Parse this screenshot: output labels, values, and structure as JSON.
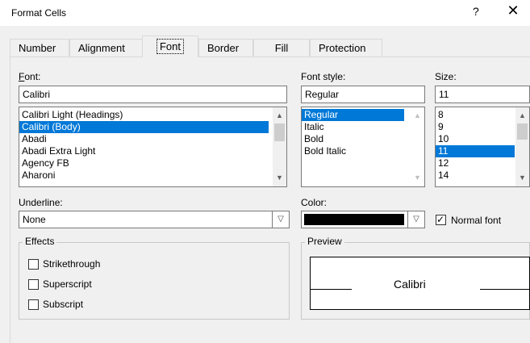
{
  "window": {
    "title": "Format Cells",
    "help": "?",
    "close": "✕"
  },
  "tabs": [
    "Number",
    "Alignment",
    "Font",
    "Border",
    "Fill",
    "Protection"
  ],
  "font": {
    "label": "Font:",
    "value": "Calibri",
    "items": [
      "Calibri Light (Headings)",
      "Calibri (Body)",
      "Abadi",
      "Abadi Extra Light",
      "Agency FB",
      "Aharoni"
    ],
    "selected": "Calibri (Body)"
  },
  "font_style": {
    "label": "Font style:",
    "value": "Regular",
    "items": [
      "Regular",
      "Italic",
      "Bold",
      "Bold Italic"
    ],
    "selected": "Regular"
  },
  "size": {
    "label": "Size:",
    "value": "11",
    "items": [
      "8",
      "9",
      "10",
      "11",
      "12",
      "14"
    ],
    "selected": "11"
  },
  "underline": {
    "label": "Underline:",
    "value": "None"
  },
  "color": {
    "label": "Color:",
    "swatch": "#000000"
  },
  "normal_font": {
    "label": "Normal font",
    "checked": true
  },
  "effects": {
    "title": "Effects",
    "strikethrough": "Strikethrough",
    "superscript": "Superscript",
    "subscript": "Subscript"
  },
  "preview": {
    "title": "Preview",
    "sample": "Calibri"
  },
  "colors": {
    "selection": "#0078d7",
    "background": "#f0f0f0"
  }
}
